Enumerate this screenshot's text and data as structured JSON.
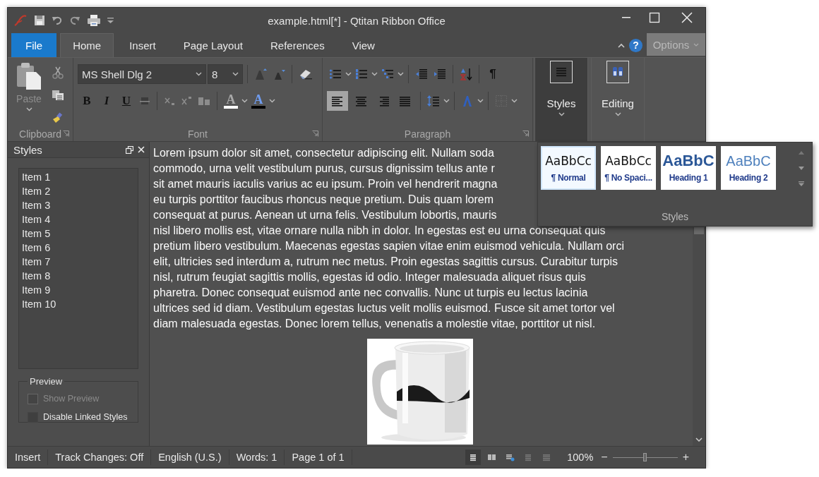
{
  "window": {
    "title": "example.html[*] - Qtitan Ribbon Office"
  },
  "tabs": [
    {
      "label": "File",
      "kind": "file",
      "selected": false
    },
    {
      "label": "Home",
      "kind": "tab",
      "selected": true
    },
    {
      "label": "Insert",
      "kind": "tab",
      "selected": false
    },
    {
      "label": "Page Layout",
      "kind": "tab",
      "selected": false
    },
    {
      "label": "References",
      "kind": "tab",
      "selected": false
    },
    {
      "label": "View",
      "kind": "tab",
      "selected": false
    }
  ],
  "help_label": "?",
  "options_button": {
    "label": "Options"
  },
  "ribbon": {
    "clipboard": {
      "paste_label": "Paste",
      "group_label": "Clipboard"
    },
    "font": {
      "font_name": "MS Shell Dlg 2",
      "font_size": "8",
      "group_label": "Font",
      "format_buttons": [
        {
          "kind": "bold",
          "label": "B",
          "disabled": false
        },
        {
          "kind": "italic",
          "label": "I",
          "disabled": false
        },
        {
          "kind": "underline",
          "label": "U",
          "disabled": false
        },
        {
          "kind": "strikethrough",
          "disabled": true
        },
        {
          "kind": "subscript",
          "disabled": true
        },
        {
          "kind": "superscript",
          "disabled": true
        },
        {
          "kind": "change-case",
          "disabled": true
        }
      ],
      "color_buttons": [
        {
          "label": "A",
          "kind": "highlight",
          "color": "#ffffff"
        },
        {
          "label": "A",
          "kind": "font-color",
          "color": "#000000"
        }
      ]
    },
    "paragraph": {
      "group_label": "Paragraph",
      "pilcrow": "¶",
      "align_buttons": [
        {
          "kind": "left",
          "selected": true
        },
        {
          "kind": "center",
          "selected": false
        },
        {
          "kind": "right",
          "selected": false
        },
        {
          "kind": "justify",
          "selected": false
        }
      ]
    },
    "large_buttons": [
      {
        "label": "Styles",
        "kind": "styles",
        "selected": true
      },
      {
        "label": "Editing",
        "kind": "editing",
        "selected": false
      }
    ]
  },
  "styles_pane": {
    "title": "Styles",
    "items": [
      "Item 1",
      "Item 2",
      "Item 3",
      "Item 4",
      "Item 5",
      "Item 6",
      "Item 7",
      "Item 8",
      "Item 9",
      "Item 10"
    ],
    "preview": {
      "title": "Preview",
      "options": [
        {
          "label": "Show Preview",
          "checked": false,
          "disabled": true
        },
        {
          "label": "Disable Linked Styles",
          "checked": false,
          "disabled": false
        }
      ]
    }
  },
  "document": {
    "lines": [
      "Lorem ipsum dolor sit amet, consectetur adipiscing elit. Nullam soda",
      "commodo, urna velit vestibulum purus, cursus dignissim tellus ante r",
      "sit amet mauris iaculis varius ac eu ipsum. Proin vel hendrerit magna",
      "eu turpis porttitor faucibus rhoncus neque pretium. Duis quam lorem",
      "consequat at purus. Aenean ut urna felis. Vestibulum lobortis, mauris",
      "nisl libero mollis est, vitae ornare nulla nibh in dolor. In egestas est eu urna consequat quis",
      "pretium libero vestibulum. Maecenas egestas sapien vitae enim euismod vehicula. Nullam orci",
      "elit, ultricies sed interdum a, rutrum nec metus. Proin egestas sagittis cursus. Curabitur turpis",
      "nisl, rutrum feugiat sagittis mollis, egestas id odio. Integer malesuada aliquet risus quis",
      "pharetra. Donec consequat euismod ante nec convallis. Nunc ut turpis eu lectus lacinia",
      "ultrices sed id diam. Vestibulum egestas luctus velit mollis euismod. Fusce sit amet tortor vel",
      "diam malesuada egestas. Donec lorem tellus, venenatis a molestie vitae, porttitor ut nisl."
    ]
  },
  "status_bar": {
    "items": [
      "Insert",
      "Track Changes: Off",
      "English (U.S.)",
      "Words: 1",
      "Page 1 of 1"
    ],
    "view_buttons": [
      {
        "selected": true
      },
      {
        "selected": false
      },
      {
        "selected": false
      },
      {
        "selected": false
      },
      {
        "selected": false
      }
    ],
    "zoom": "100%",
    "zoom_out": "−",
    "zoom_in": "+",
    "zoom_slider": {
      "level": 0.5
    }
  },
  "styles_gallery": {
    "label": "Styles",
    "items": [
      {
        "sample": "AaBbCc",
        "label": "¶ Normal",
        "kind": "plain",
        "selected": true
      },
      {
        "sample": "AaBbCc",
        "label": "¶ No Spaci...",
        "kind": "plain",
        "selected": false
      },
      {
        "sample": "AaBbC",
        "label": "Heading 1",
        "kind": "heading1",
        "selected": false
      },
      {
        "sample": "AaBbC",
        "label": "Heading 2",
        "kind": "heading2",
        "selected": false
      }
    ]
  }
}
